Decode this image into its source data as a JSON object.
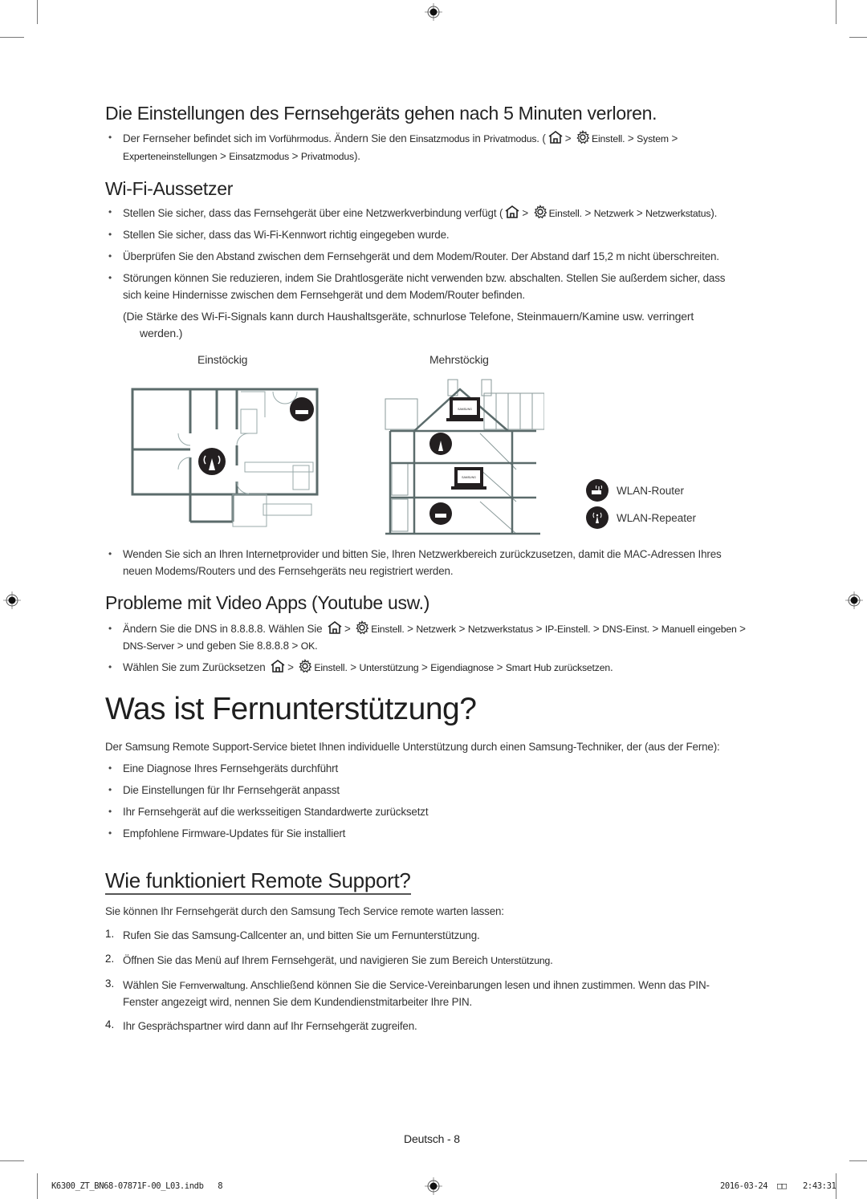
{
  "section_settings_lost": {
    "heading": "Die Einstellungen des Fernsehgeräts gehen nach 5 Minuten verloren.",
    "bullet1": {
      "text_a": "Der Fernseher befindet sich im ",
      "bold_a": "Vorführmodus",
      "text_b": ". Ändern Sie den ",
      "bold_b": "Einsatzmodus",
      "text_c": " in ",
      "bold_c": "Privatmodus",
      "text_d": ". (",
      "path1": [
        "Einstell.",
        "System"
      ],
      "path2": [
        "Experteneinstellungen",
        "Einsatzmodus",
        "Privatmodus"
      ],
      "end": ")."
    }
  },
  "section_wifi": {
    "heading": "Wi-Fi-Aussetzer",
    "bullet1": {
      "text": "Stellen Sie sicher, dass das Fernsehgerät über eine Netzwerkverbindung verfügt (",
      "path": [
        "Einstell.",
        "Netzwerk",
        "Netzwerkstatus"
      ],
      "end": ")."
    },
    "bullet2": "Stellen Sie sicher, dass das Wi-Fi-Kennwort richtig eingegeben wurde.",
    "bullet3": "Überprüfen Sie den Abstand zwischen dem Fernsehgerät und dem Modem/Router. Der Abstand darf 15,2 m nicht überschreiten.",
    "bullet4_line1": "Störungen können Sie reduzieren, indem Sie Drahtlosgeräte nicht verwenden bzw. abschalten. Stellen Sie außerdem sicher, dass",
    "bullet4_line2": "sich keine Hindernisse zwischen dem Fernsehgerät und dem Modem/Router befinden.",
    "note_line1": "(Die Stärke des Wi-Fi-Signals kann durch Haushaltsgeräte, schnurlose Telefone, Steinmauern/Kamine usw. verringert",
    "note_line2": "werden.)",
    "diagram": {
      "label_single": "Einstöckig",
      "label_multi": "Mehrstöckig",
      "laptop_brand": "SAMSUNG",
      "legend": [
        {
          "icon": "wlan-router-icon",
          "label": "WLAN-Router"
        },
        {
          "icon": "wlan-repeater-icon",
          "label": "WLAN-Repeater"
        }
      ]
    },
    "bullet5_line1": "Wenden Sie sich an Ihren Internetprovider und bitten Sie, Ihren Netzwerkbereich zurückzusetzen, damit die MAC-Adressen Ihres",
    "bullet5_line2": "neuen Modems/Routers und des Fernsehgeräts neu registriert werden."
  },
  "section_video": {
    "heading": "Probleme mit Video Apps (Youtube usw.)",
    "bullet1": {
      "text": "Ändern Sie die DNS in 8.8.8.8. Wählen Sie ",
      "path1": [
        "Einstell.",
        "Netzwerk",
        "Netzwerkstatus",
        "IP-Einstell.",
        "DNS-Einst.",
        "Manuell eingeben"
      ],
      "path2_start": "DNS-Server",
      "text2": " und geben Sie 8.8.8.8 ",
      "ok": "OK",
      "end": "."
    },
    "bullet2": {
      "text": "Wählen Sie zum Zurücksetzen ",
      "path": [
        "Einstell.",
        "Unterstützung",
        "Eigendiagnose",
        "Smart Hub zurücksetzen"
      ],
      "end": "."
    }
  },
  "section_remote": {
    "heading": "Was ist Fernunterstützung?",
    "intro": "Der Samsung Remote Support-Service bietet Ihnen individuelle Unterstützung durch einen Samsung-Techniker, der (aus der Ferne):",
    "bullets": [
      "Eine Diagnose Ihres Fernsehgeräts durchführt",
      "Die Einstellungen für Ihr Fernsehgerät anpasst",
      "Ihr Fernsehgerät auf die werksseitigen Standardwerte zurücksetzt",
      "Empfohlene Firmware-Updates für Sie installiert"
    ]
  },
  "section_how": {
    "heading": "Wie funktioniert Remote Support?",
    "intro": "Sie können Ihr Fernsehgerät durch den Samsung Tech Service remote warten lassen:",
    "steps": [
      {
        "num": "1.",
        "text": "Rufen Sie das Samsung-Callcenter an, und bitten Sie um Fernunterstützung."
      },
      {
        "num": "2.",
        "text": "Öffnen Sie das Menü auf Ihrem Fernsehgerät, und navigieren Sie zum Bereich ",
        "bold": "Unterstützung",
        "end": "."
      },
      {
        "num": "3.",
        "text": "Wählen Sie ",
        "bold": "Fernverwaltung",
        "text2": ". Anschließend können Sie die Service-Vereinbarungen lesen und ihnen zustimmen. Wenn das PIN-",
        "line2": "Fenster angezeigt wird, nennen Sie dem Kundendienstmitarbeiter Ihre PIN."
      },
      {
        "num": "4.",
        "text": "Ihr Gesprächspartner wird dann auf Ihr Fernsehgerät zugreifen."
      }
    ]
  },
  "page_footer": {
    "page_label": "Deutsch - 8",
    "file_name": "K6300_ZT_BN68-07871F-00_L03.indb   8",
    "date": "2016-03-24",
    "time_glyphs": "□□",
    "time": "2:43:31"
  },
  "separator": ">",
  "bullet_char": "•"
}
